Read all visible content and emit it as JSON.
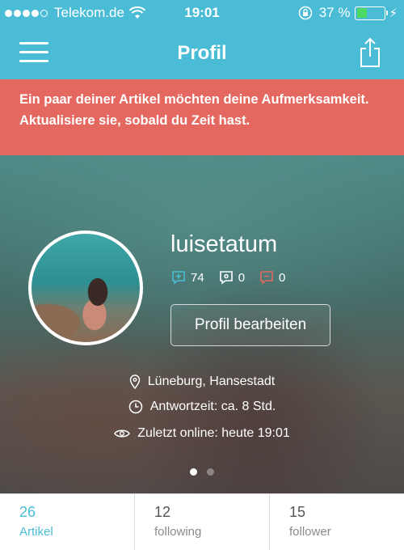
{
  "status_bar": {
    "carrier": "Telekom.de",
    "time": "19:01",
    "battery_percent": "37 %",
    "battery_level": 0.37
  },
  "nav": {
    "title": "Profil"
  },
  "banner": {
    "text": "Ein paar deiner Artikel möchten deine Aufmerksamkeit. Aktualisiere sie, sobald du Zeit hast."
  },
  "profile": {
    "username": "luisetatum",
    "ratings": {
      "positive": "74",
      "neutral": "0",
      "negative": "0"
    },
    "edit_button": "Profil bearbeiten",
    "location": "Lüneburg, Hansestadt",
    "response_time": "Antwortzeit: ca. 8 Std.",
    "last_online": "Zuletzt online: heute 19:01"
  },
  "pager": {
    "count": 2,
    "active": 0
  },
  "tabs": [
    {
      "count": "26",
      "label": "Artikel",
      "active": true
    },
    {
      "count": "12",
      "label": "following",
      "active": false
    },
    {
      "count": "15",
      "label": "follower",
      "active": false
    }
  ],
  "colors": {
    "accent": "#4bbcd6",
    "alert": "#e4685f",
    "positive": "#4bbcd6",
    "negative": "#e4685f"
  }
}
